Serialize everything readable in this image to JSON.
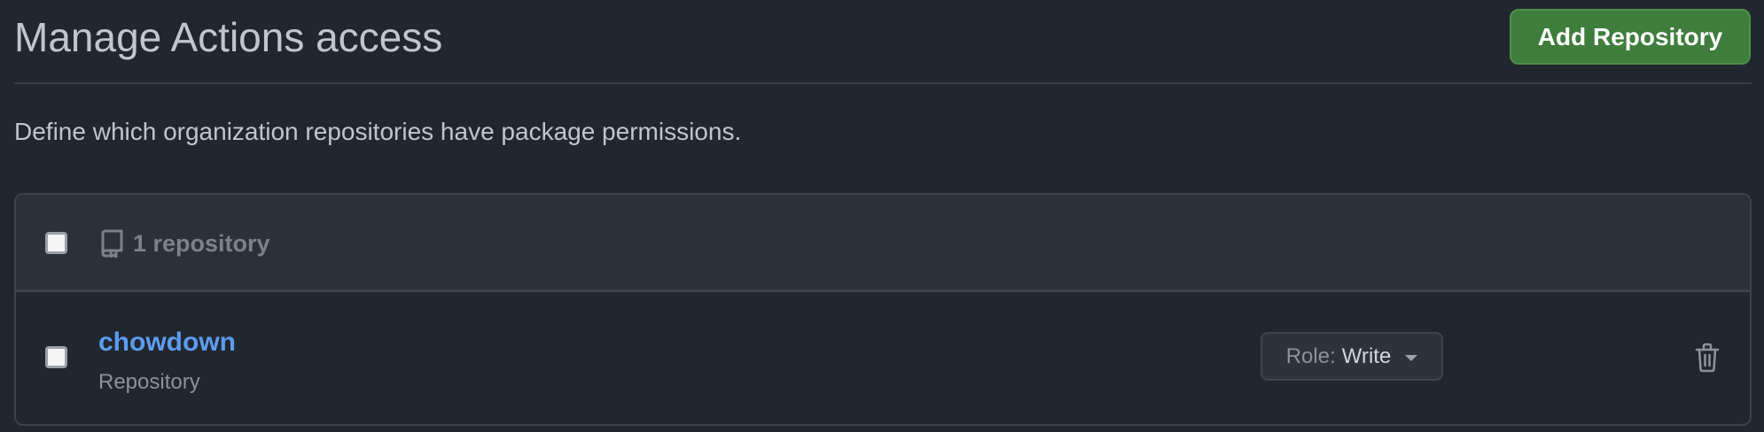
{
  "header": {
    "title": "Manage Actions access",
    "add_button_label": "Add Repository"
  },
  "description": "Define which organization repositories have package permissions.",
  "list": {
    "header": {
      "icon": "repo-icon",
      "count_label": "1 repository"
    },
    "rows": [
      {
        "name": "chowdown",
        "type": "Repository",
        "role_label": "Role:",
        "role_value": "Write",
        "delete_icon": "trash-icon"
      }
    ]
  },
  "colors": {
    "background": "#22262e",
    "primary_button": "#3f7d3c",
    "link": "#5b9cf0"
  }
}
